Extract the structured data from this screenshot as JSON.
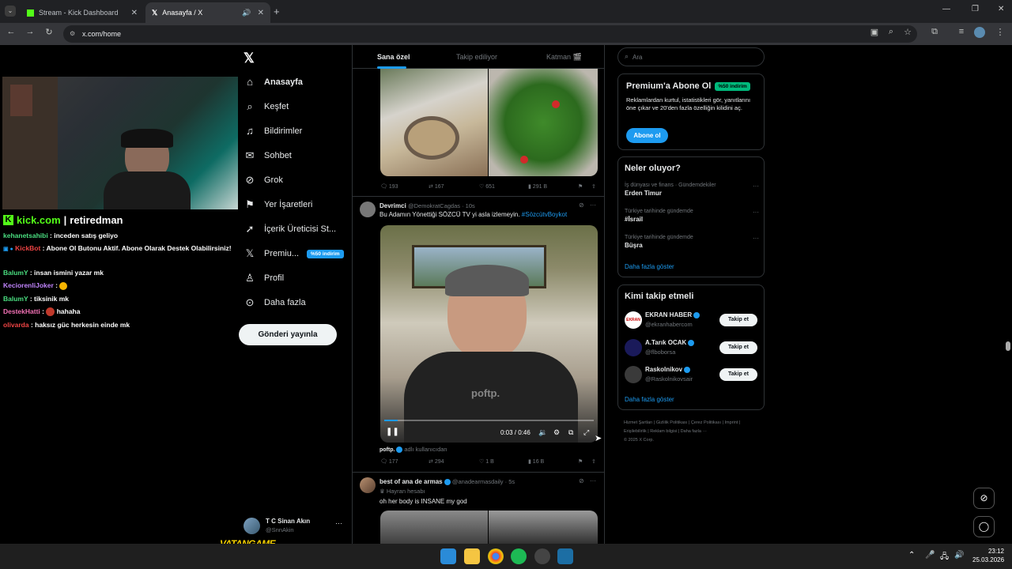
{
  "browser": {
    "tabs": [
      {
        "label": "Stream - Kick Dashboard"
      },
      {
        "label": "Anasayfa / X"
      }
    ],
    "url": "x.com/home"
  },
  "stream": {
    "brand": "kick.com",
    "channel": "retiredman",
    "chat": [
      {
        "user": "kehanetsahibi",
        "user_color": "#4ade80",
        "text": " : inceden satış geliyo"
      },
      {
        "user": "KickBot",
        "user_color": "#ef4444",
        "text": " : Abone Ol Butonu Aktif. Abone Olarak Destek Olabilirsiniz!"
      },
      {
        "user": "BalumY",
        "user_color": "#4ade80",
        "text": " : insan ismini yazar mk"
      },
      {
        "user": "KeciorenliJoker",
        "user_color": "#c084fc",
        "text": " : "
      },
      {
        "user": "BalumY",
        "user_color": "#4ade80",
        "text": " : tiksinik mk"
      },
      {
        "user": "DestekHatti",
        "user_color": "#f472b6",
        "text": " : hahaha"
      },
      {
        "user": "olivarda",
        "user_color": "#ef4444",
        "text": " : haksız güc herkesin einde mk"
      }
    ],
    "overlay_logo": "VATANGAME"
  },
  "x_sidebar": {
    "nav": [
      {
        "label": "Anasayfa",
        "icon": "home-icon"
      },
      {
        "label": "Keşfet",
        "icon": "search-icon"
      },
      {
        "label": "Bildirimler",
        "icon": "bell-icon"
      },
      {
        "label": "Sohbet",
        "icon": "mail-icon"
      },
      {
        "label": "Grok",
        "icon": "grok-icon"
      },
      {
        "label": "Yer İşaretleri",
        "icon": "bookmark-icon"
      },
      {
        "label": "İçerik Üreticisi St...",
        "icon": "rocket-icon"
      },
      {
        "label": "Premiu...",
        "icon": "x-logo-icon",
        "badge": "%50 indirim"
      },
      {
        "label": "Profil",
        "icon": "person-icon"
      },
      {
        "label": "Daha fazla",
        "icon": "more-circle-icon"
      }
    ],
    "post_button": "Gönderi yayınla",
    "account": {
      "name": "T C Sinan Akın",
      "handle": "@SnnAkin"
    }
  },
  "feed": {
    "tabs": [
      "Sana özel",
      "Takip ediliyor",
      "Katman 🎬"
    ],
    "post0_actions": [
      "193",
      "167",
      "651",
      "291 B"
    ],
    "post1": {
      "author": "Devrimci",
      "handle": "@DemokratCagdas · 10s",
      "text": "Bu Adamın Yönettiği SÖZCÜ TV yi asla izlemeyin.",
      "hashtag": "#SözcütvBoykot",
      "video_time": "0:03 / 0:46",
      "watermark": "poftp.",
      "source_name": "poftp.",
      "source_note": "adlı kullanıcıdan",
      "actions": [
        "177",
        "294",
        "1 B",
        "16 B"
      ]
    },
    "post2": {
      "author": "best of ana de armas",
      "handle": "@anadearmasdaily · 5s",
      "subtitle": "Hayran hesabı",
      "text": "oh her body is INSANE my god"
    }
  },
  "right": {
    "search_placeholder": "Ara",
    "premium": {
      "title": "Premium'a Abone Ol",
      "badge": "%50 indirim",
      "body": "Reklamlardan kurtul, istatistikleri gör, yanıtlarını öne çıkar ve 20'den fazla özelliğin kilidini aç.",
      "button": "Abone ol"
    },
    "trends": {
      "title": "Neler oluyor?",
      "items": [
        {
          "context": "İş dünyası ve finans · Gündemdekiler",
          "name": "Erden Timur"
        },
        {
          "context": "Türkiye tarihinde gündemde",
          "name": "#İsrail"
        },
        {
          "context": "Türkiye tarihinde gündemde",
          "name": "Büşra"
        }
      ],
      "more": "Daha fazla göster"
    },
    "follow": {
      "title": "Kimi takip etmeli",
      "items": [
        {
          "name": "EKRAN HABER",
          "handle": "@ekranhabercom",
          "button": "Takip et"
        },
        {
          "name": "A.Tarık OCAK",
          "handle": "@flboborsa",
          "button": "Takip et"
        },
        {
          "name": "Raskolnikov",
          "handle": "@Raskolnikovsair",
          "button": "Takip et"
        }
      ],
      "more": "Daha fazla göster"
    },
    "footer": [
      "Hizmet Şartları",
      "Gizlilik Politikası",
      "Çerez Politikası",
      "Imprint",
      "Erişilebilirlik",
      "Reklam bilgisi",
      "Daha fazla ···",
      "© 2025 X Corp."
    ]
  },
  "taskbar": {
    "time": "23:12",
    "date": "25.03.2026"
  },
  "colors": {
    "accent": "#1d9bf0",
    "kick_green": "#53fc18",
    "premium_badge": "#00ba7c"
  }
}
